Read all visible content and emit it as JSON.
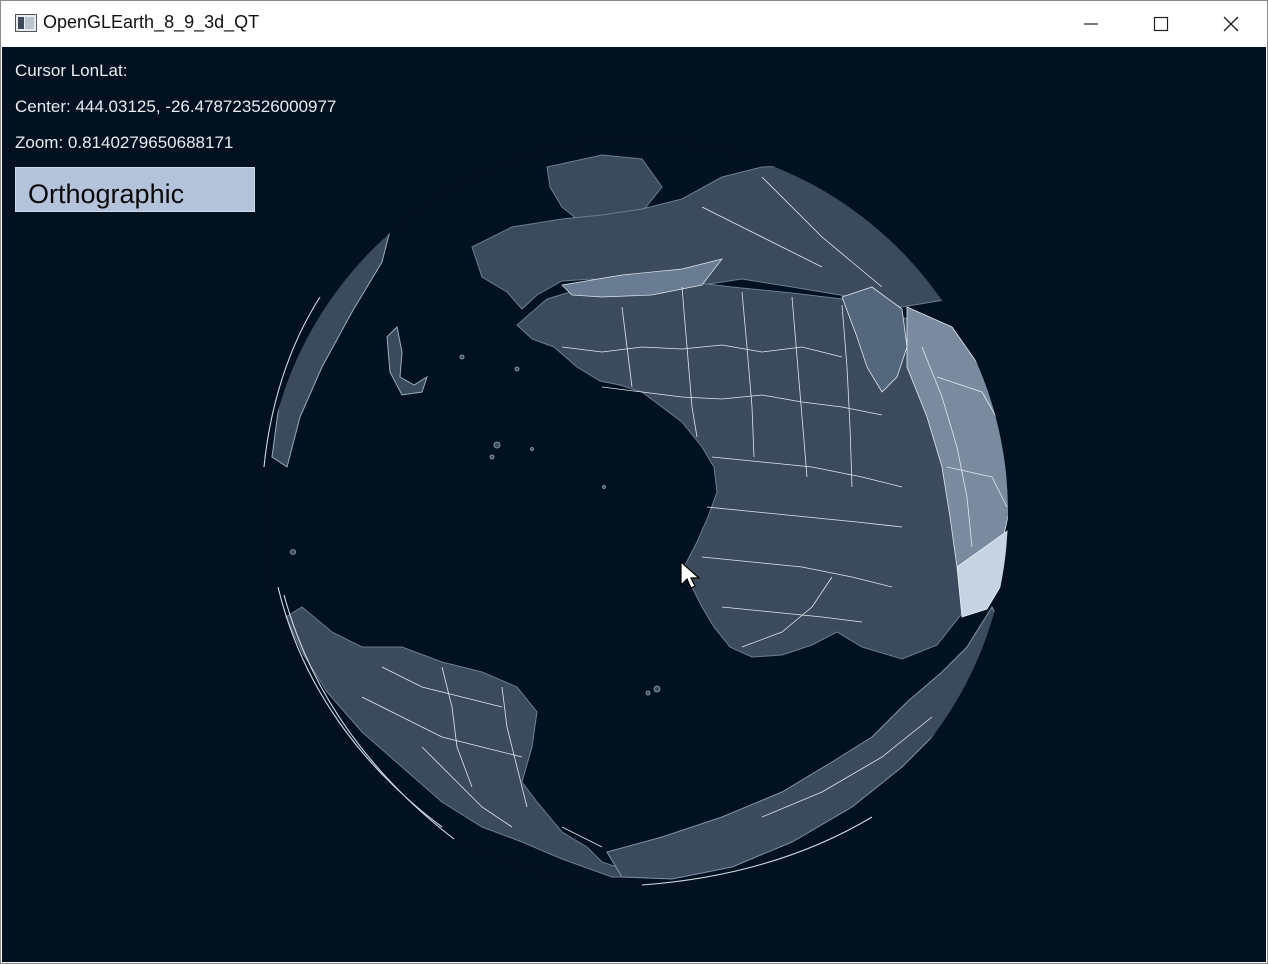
{
  "window": {
    "title": "OpenGLEarth_8_9_3d_QT",
    "icon": "app-window-icon",
    "controls": {
      "minimize": "minimize-icon",
      "maximize": "maximize-icon",
      "close": "close-icon"
    }
  },
  "hud": {
    "cursor_label": "Cursor LonLat:",
    "center_label": "Center: 444.03125, -26.478723526000977",
    "zoom_label": "Zoom: 0.8140279650688171"
  },
  "projection_button": {
    "label": "Orthographic"
  },
  "colors": {
    "background": "#021120",
    "land": "#3b4b5d",
    "land_edge": "#6b7d92",
    "borders": "#dfe6ee",
    "button": "#b3c3d9"
  }
}
